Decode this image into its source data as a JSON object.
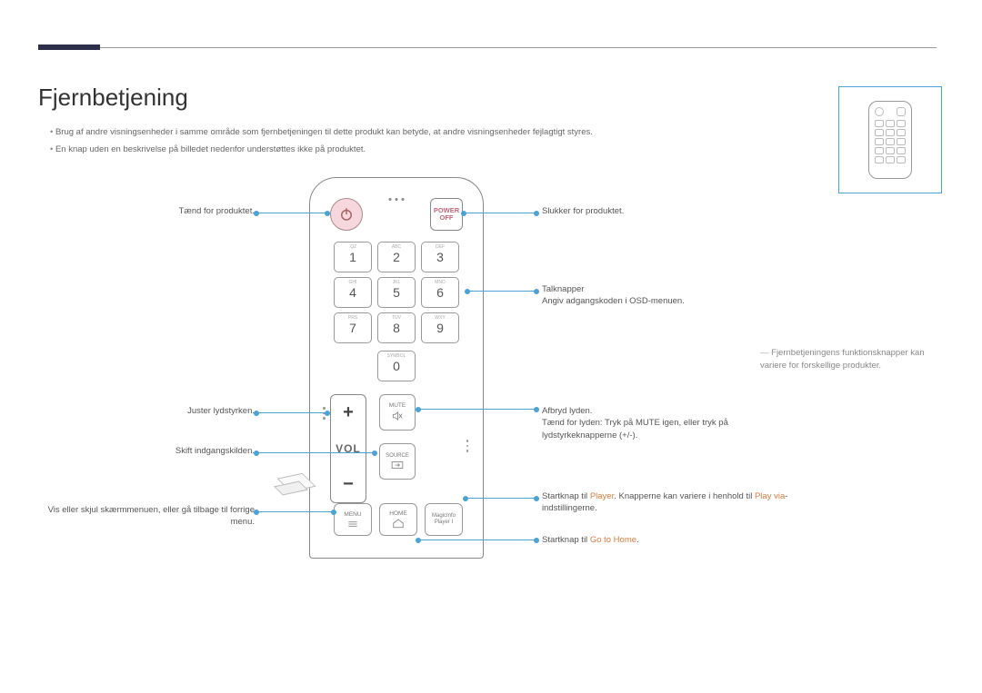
{
  "title": "Fjernbetjening",
  "notes": [
    "Brug af andre visningsenheder i samme område som fjernbetjeningen til dette produkt kan betyde, at andre visningsenheder fejlagtigt styres.",
    "En knap uden en beskrivelse på billedet nedenfor understøttes ikke på produktet."
  ],
  "remote": {
    "power_off_top": "POWER",
    "power_off_bottom": "OFF",
    "keys": [
      {
        "n": "1",
        "t": ".QZ"
      },
      {
        "n": "2",
        "t": "ABC"
      },
      {
        "n": "3",
        "t": "DEF"
      },
      {
        "n": "4",
        "t": "GHI"
      },
      {
        "n": "5",
        "t": "JKL"
      },
      {
        "n": "6",
        "t": "MNO"
      },
      {
        "n": "7",
        "t": "PRS"
      },
      {
        "n": "8",
        "t": "TUV"
      },
      {
        "n": "9",
        "t": "WXY"
      }
    ],
    "key0": {
      "n": "0",
      "t": "SYMBOL"
    },
    "vol": {
      "plus": "+",
      "label": "VOL",
      "minus": "−"
    },
    "mute": "MUTE",
    "source": "SOURCE",
    "menu": "MENU",
    "home": "HOME",
    "magic_top": "MagicInfo",
    "magic_bottom": "Player I"
  },
  "callouts": {
    "left": {
      "power": "Tænd for produktet.",
      "vol": "Juster lydstyrken.",
      "source": "Skift indgangskilden.",
      "menu": "Vis eller skjul skærmmenuen, eller gå tilbage til forrige menu."
    },
    "right": {
      "poweroff": "Slukker for produktet.",
      "num_top": "Talknapper",
      "num_sub": "Angiv adgangskoden i OSD-menuen.",
      "mute_top": "Afbryd lyden.",
      "mute_line1": "Tænd for lyden: Tryk på ",
      "mute_word": "MUTE",
      "mute_line2": " igen, eller tryk på lydstyrkeknapperne (+/-).",
      "player_line1": "Startknap til ",
      "player_word": "Player",
      "player_line2": ". Knapperne kan variere i henhold til ",
      "player_word2": "Play via",
      "player_line3": "-indstillingerne.",
      "home_line1": "Startknap til ",
      "home_word": "Go to Home",
      "home_line2": "."
    }
  },
  "sidenote": "Fjernbetjeningens funktionsknapper kan variere for forskellige produkter."
}
